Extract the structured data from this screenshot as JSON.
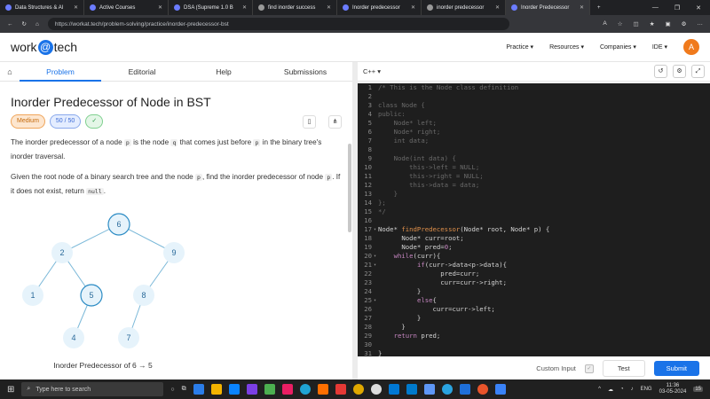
{
  "browser": {
    "tabs": [
      {
        "label": "Data Structures & Al"
      },
      {
        "label": "Active Courses"
      },
      {
        "label": "DSA (Supreme 1.0 B"
      },
      {
        "label": "find inorder success"
      },
      {
        "label": "Inorder predecessor"
      },
      {
        "label": "inorder predecessor"
      },
      {
        "label": "Inorder Predecessor",
        "active": true
      }
    ],
    "url": "https://workat.tech/problem-solving/practice/inorder-predecessor-bst"
  },
  "site": {
    "logo_left": "work",
    "logo_at": "@",
    "logo_right": "tech",
    "nav": [
      "Practice ▾",
      "Resources ▾",
      "Companies ▾",
      "IDE ▾"
    ],
    "avatar": "A"
  },
  "problem": {
    "tabs": [
      "Problem",
      "Editorial",
      "Help",
      "Submissions"
    ],
    "title": "Inorder Predecessor of Node in BST",
    "difficulty": "Medium",
    "score": "50 / 50",
    "solved_mark": "✓",
    "p1a": "The inorder predecessor of a node ",
    "p1code1": "p",
    "p1b": " is the node ",
    "p1code2": "q",
    "p1c": " that comes just before ",
    "p1code3": "p",
    "p1d": " in the binary tree's inorder traversal.",
    "p2a": "Given the root node of a binary search tree and the node ",
    "p2code1": "p",
    "p2b": ", find the inorder predecessor of node ",
    "p2code2": "p",
    "p2c": ". If it does not exist, return ",
    "p2code3": "null",
    "p2d": ".",
    "figure_caption": "Inorder Predecessor of 6 → 5",
    "tree_nodes": [
      "6",
      "2",
      "9",
      "1",
      "5",
      "8",
      "4",
      "7"
    ]
  },
  "editor": {
    "language": "C++ ▾",
    "lines": [
      "/* This is the Node class definition",
      "",
      "class Node {",
      "public:",
      "    Node* left;",
      "    Node* right;",
      "    int data;",
      "",
      "    Node(int data) {",
      "        this->left = NULL;",
      "        this->right = NULL;",
      "        this->data = data;",
      "    }",
      "};",
      "*/",
      "",
      "Node* findPredecessor(Node* root, Node* p) {",
      "      Node* curr=root;",
      "      Node* pred=0;",
      "    while(curr){",
      "          if(curr->data<p->data){",
      "                pred=curr;",
      "                curr=curr->right;",
      "          }",
      "          else{",
      "              curr=curr->left;",
      "          }",
      "      }",
      "    return pred;",
      "",
      "}"
    ],
    "custom_input": "Custom Input",
    "test": "Test",
    "submit": "Submit"
  },
  "taskbar": {
    "search": "Type here to search",
    "lang": "ENG",
    "time": "11:36",
    "date": "03-05-2024",
    "badge": "15"
  }
}
